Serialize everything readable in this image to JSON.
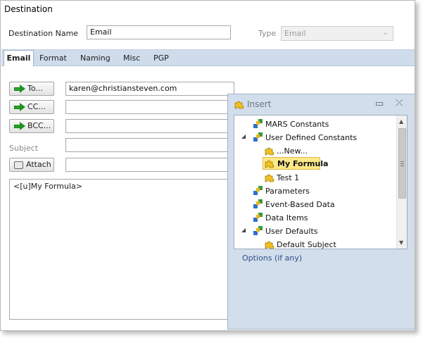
{
  "window": {
    "title": "Destination"
  },
  "form": {
    "destination_name_label": "Destination Name",
    "destination_name_value": "Email",
    "type_label": "Type",
    "type_value": "Email"
  },
  "tabs": [
    {
      "label": "Email",
      "active": true
    },
    {
      "label": "Format"
    },
    {
      "label": "Naming"
    },
    {
      "label": "Misc"
    },
    {
      "label": "PGP"
    }
  ],
  "email": {
    "to_button": "To...",
    "to_value": "karen@christiansteven.com",
    "cc_button": "CC...",
    "cc_value": "",
    "bcc_button": "BCC...",
    "bcc_value": "",
    "subject_label": "Subject",
    "subject_value": "",
    "attach_button": "Attach",
    "attach_value": "",
    "body": "<[u]My Formula>"
  },
  "insert_panel": {
    "title": "Insert",
    "minimize": "▭",
    "close": "⤫",
    "items": [
      {
        "label": "MARS Constants"
      },
      {
        "label": "User Defined Constants",
        "expanded": true
      },
      {
        "label": "...New..."
      },
      {
        "label": "My Formula",
        "selected": true
      },
      {
        "label": "Test 1"
      },
      {
        "label": "Parameters"
      },
      {
        "label": "Event-Based Data"
      },
      {
        "label": "Data Items"
      },
      {
        "label": "User Defaults",
        "expanded": true
      },
      {
        "label": "Default Subject"
      }
    ],
    "options_label": "Options (if any)"
  },
  "colors": {
    "tab_strip": "#cfdcec",
    "panel_bg": "#d3deec",
    "selection": "#fde88a",
    "link": "#2b4f8a"
  }
}
